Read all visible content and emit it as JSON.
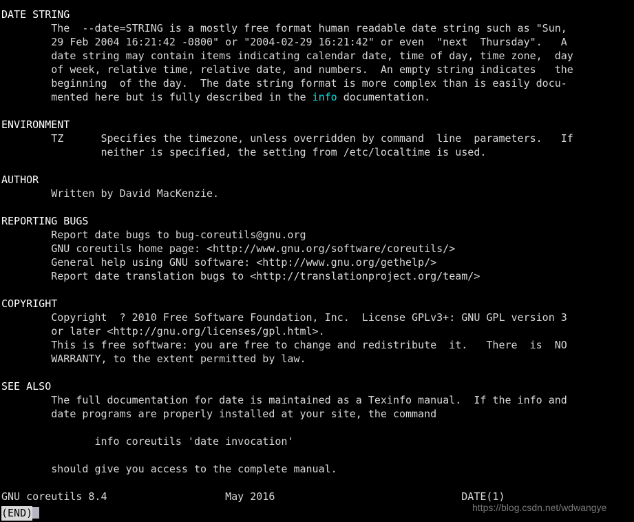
{
  "terminal": {
    "program": "less (man pager)",
    "background_color": "#000000",
    "foreground_color": "#d8d8d8",
    "highlight_color": "#00e5e5",
    "columns": 103,
    "rows": 38
  },
  "document": {
    "manpage_name": "DATE(1)",
    "sections": [
      {
        "heading": "DATE STRING",
        "lines": [
          "        The  --date=STRING is a mostly free format human readable date string such as \"Sun,",
          "        29 Feb 2004 16:21:42 -0800\" or \"2004-02-29 16:21:42\" or even  \"next  Thursday\".   A",
          "        date string may contain items indicating calendar date, time of day, time zone,  day",
          "        of week, relative time, relative date, and numbers.  An empty string indicates   the",
          "        beginning  of the day.  The date string format is more complex than is easily docu-",
          "        mented here but is fully described in the info documentation."
        ]
      },
      {
        "heading": "ENVIRONMENT",
        "lines": [
          "        TZ      Specifies the timezone, unless overridden by command  line  parameters.   If",
          "                neither is specified, the setting from /etc/localtime is used."
        ]
      },
      {
        "heading": "AUTHOR",
        "lines": [
          "        Written by David MacKenzie."
        ]
      },
      {
        "heading": "REPORTING BUGS",
        "lines": [
          "        Report date bugs to bug-coreutils@gnu.org",
          "        GNU coreutils home page: <http://www.gnu.org/software/coreutils/>",
          "        General help using GNU software: <http://www.gnu.org/gethelp/>",
          "        Report date translation bugs to <http://translationproject.org/team/>"
        ]
      },
      {
        "heading": "COPYRIGHT",
        "lines": [
          "        Copyright  ? 2010 Free Software Foundation, Inc.  License GPLv3+: GNU GPL version 3",
          "        or later <http://gnu.org/licenses/gpl.html>.",
          "        This is free software: you are free to change and redistribute  it.   There  is  NO",
          "        WARRANTY, to the extent permitted by law."
        ]
      },
      {
        "heading": "SEE ALSO",
        "lines": [
          "        The full documentation for date is maintained as a Texinfo manual.  If the info and",
          "        date programs are properly installed at your site, the command",
          "",
          "               info coreutils 'date invocation'",
          "",
          "        should give you access to the complete manual."
        ]
      }
    ],
    "info_keyword": "info",
    "footer": {
      "left": "GNU coreutils 8.4",
      "center": "May 2016",
      "right": "DATE(1)",
      "raw": "GNU coreutils 8.4                   May 2016                              DATE(1)"
    }
  },
  "pager": {
    "prompt": "(END)",
    "cursor": "block-cursor"
  },
  "watermark": {
    "text": "https://blog.csdn.net/wdwangye"
  }
}
